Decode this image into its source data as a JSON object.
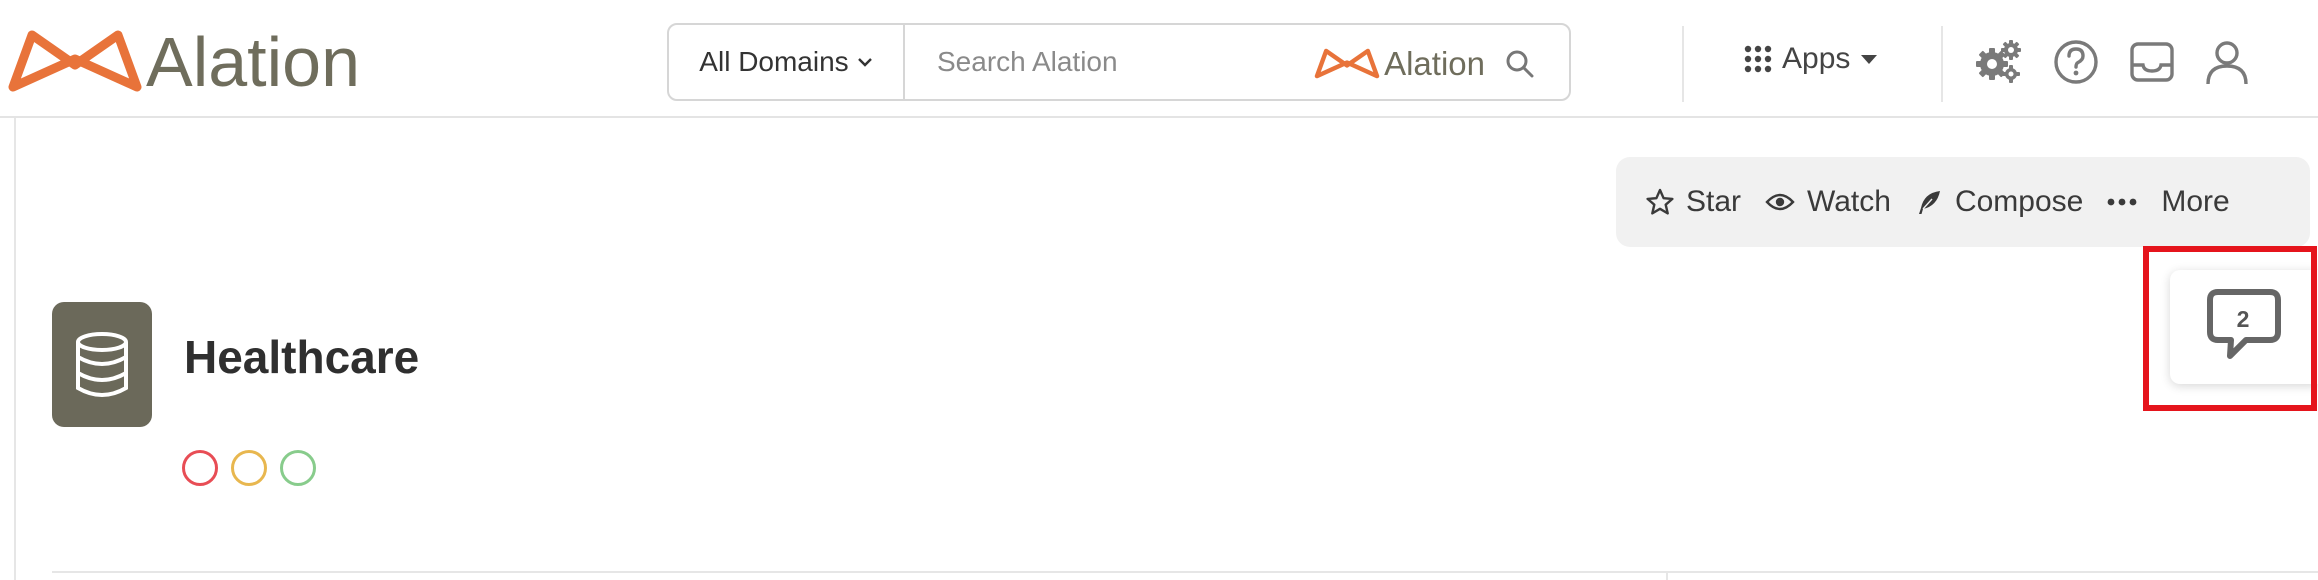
{
  "header": {
    "brand": "Alation",
    "domain_selector": "All Domains",
    "search": {
      "placeholder": "Search Alation",
      "brand": "Alation"
    },
    "apps_label": "Apps"
  },
  "actions": {
    "star": "Star",
    "watch": "Watch",
    "compose": "Compose",
    "more": "More"
  },
  "page": {
    "title": "Healthcare",
    "trust_flags": [
      {
        "name": "deprecation",
        "color": "#e84d55"
      },
      {
        "name": "warning",
        "color": "#e8b74f"
      },
      {
        "name": "endorsement",
        "color": "#88cc8c"
      }
    ]
  },
  "conversations": {
    "count": "2"
  },
  "colors": {
    "brand_orange": "#e8733a",
    "brand_text": "#6f6d5c",
    "icon_gray": "#666666",
    "highlight": "#e5141c"
  }
}
